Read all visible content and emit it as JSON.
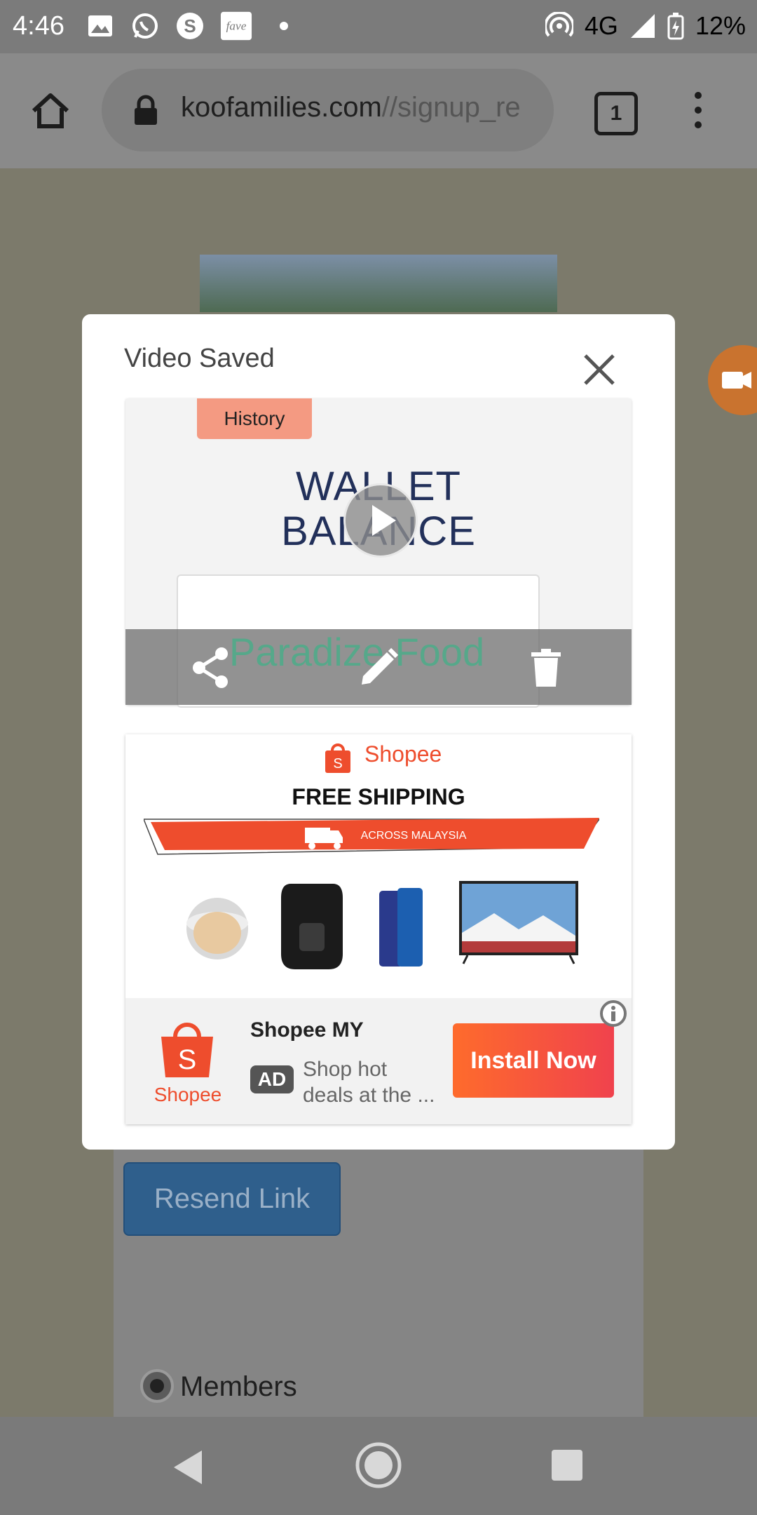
{
  "status_bar": {
    "time": "4:46",
    "network": "4G",
    "battery": "12%",
    "icons": [
      "gallery-icon",
      "whatsapp-icon",
      "skype-icon",
      "fave-icon",
      "dot-icon",
      "hotspot-icon",
      "signal-icon",
      "battery-charging-icon"
    ],
    "fave_label": "fave"
  },
  "browser": {
    "url_host": "koofamilies.com",
    "url_path": "//signup_re",
    "tab_count": "1"
  },
  "page": {
    "resend_button": "Resend Link",
    "radio_label": "Members"
  },
  "dialog": {
    "title": "Video Saved",
    "video": {
      "history_tab": "History",
      "wallet_line1": "WALLET",
      "wallet_line2": "BALANCE",
      "overlay_text": "Paradize Food"
    },
    "actions": [
      "share-icon",
      "edit-icon",
      "delete-icon"
    ]
  },
  "ad": {
    "brand_top": "Shopee",
    "headline": "FREE SHIPPING",
    "ribbon_text": "ACROSS MALAYSIA",
    "app_name": "Shopee MY",
    "badge": "AD",
    "description": "Shop hot deals at the ...",
    "logo_text": "Shopee",
    "cta": "Install Now",
    "colors": {
      "brand": "#ee4d2d",
      "cta_start": "#fe6b2c",
      "cta_end": "#f0424d"
    }
  },
  "nav": [
    "back-icon",
    "home-icon",
    "recents-icon"
  ]
}
